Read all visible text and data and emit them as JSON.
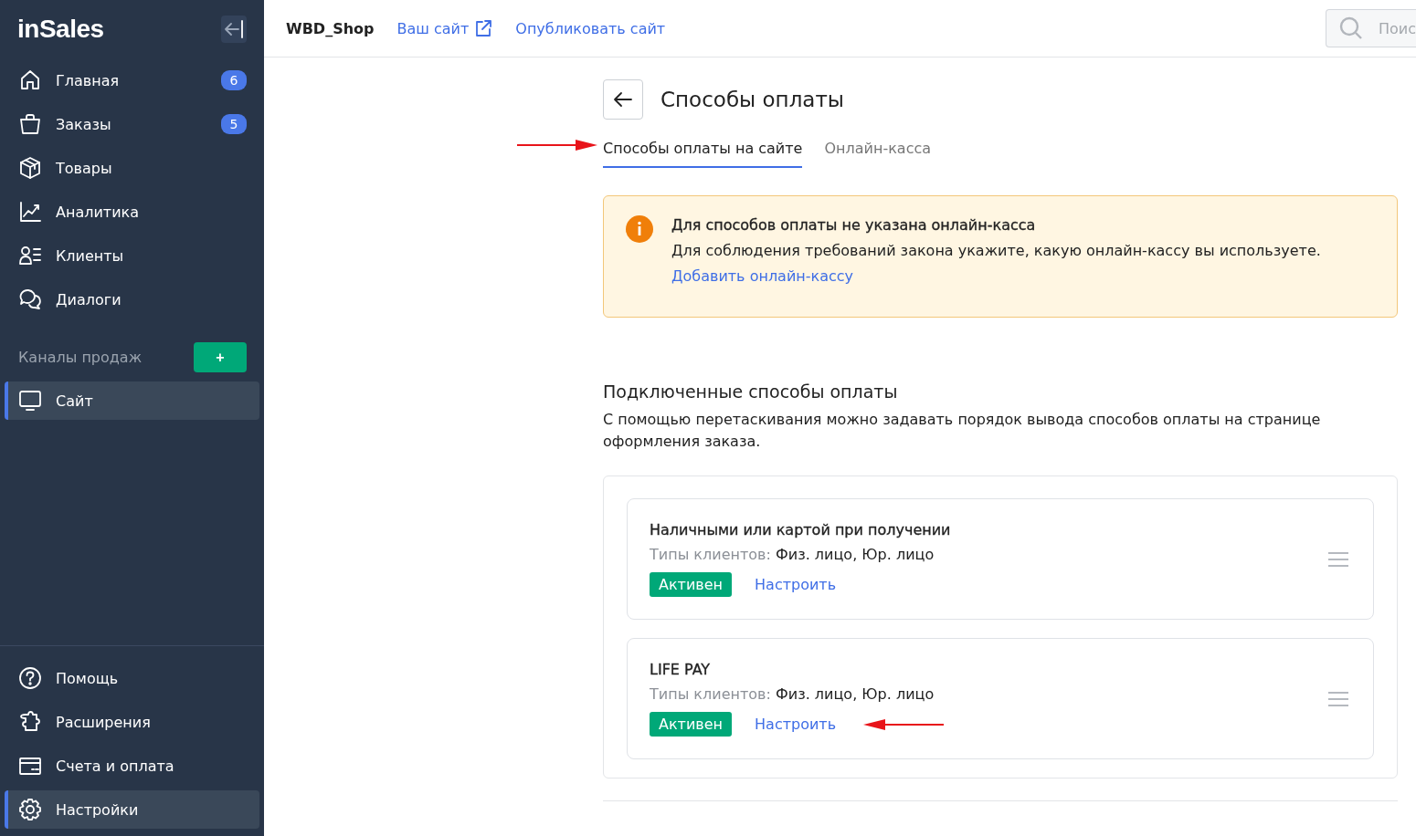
{
  "sidebar": {
    "logo": "inSales",
    "nav_items": [
      {
        "label": "Главная",
        "badge": "6",
        "selected": false
      },
      {
        "label": "Заказы",
        "badge": "5",
        "selected": false
      },
      {
        "label": "Товары",
        "selected": false
      },
      {
        "label": "Аналитика",
        "selected": false
      },
      {
        "label": "Клиенты",
        "selected": false
      },
      {
        "label": "Диалоги",
        "selected": false
      }
    ],
    "channels": {
      "title": "Каналы продаж",
      "add_button": "+",
      "items": [
        {
          "label": "Сайт",
          "selected": true
        }
      ]
    },
    "bottom_items": [
      {
        "label": "Помощь",
        "selected": false
      },
      {
        "label": "Расширения",
        "selected": false
      },
      {
        "label": "Счета и оплата",
        "selected": false
      },
      {
        "label": "Настройки",
        "selected": true
      }
    ]
  },
  "header": {
    "shop": "WBD_Shop",
    "links": [
      "Ваш сайт",
      "Опубликовать сайт"
    ],
    "search": {
      "placeholder": "Поис"
    }
  },
  "page": {
    "title": "Способы оплаты",
    "tabs": [
      {
        "label": "Способы оплаты на сайте",
        "selected": true
      },
      {
        "label": "Онлайн-касса",
        "selected": false
      }
    ],
    "alert": {
      "title": "Для способов оплаты не указана онлайн-касса",
      "text": "Для соблюдения требований закона укажите, какую онлайн-кассу вы используете.",
      "link": "Добавить онлайн-кассу"
    },
    "section": {
      "title": "Подключенные способы оплаты",
      "description": "С помощью перетаскивания можно задавать порядок вывода способов оплаты на странице оформления заказа."
    },
    "methods": [
      {
        "name": "Наличными или картой при получении",
        "types_label": "Типы клиентов:",
        "types": "Физ. лицо, Юр. лицо",
        "status": "Активен",
        "action": "Настроить"
      },
      {
        "name": "LIFE PAY",
        "types_label": "Типы клиентов:",
        "types": "Физ. лицо, Юр. лицо",
        "status": "Активен",
        "action": "Настроить"
      }
    ]
  }
}
